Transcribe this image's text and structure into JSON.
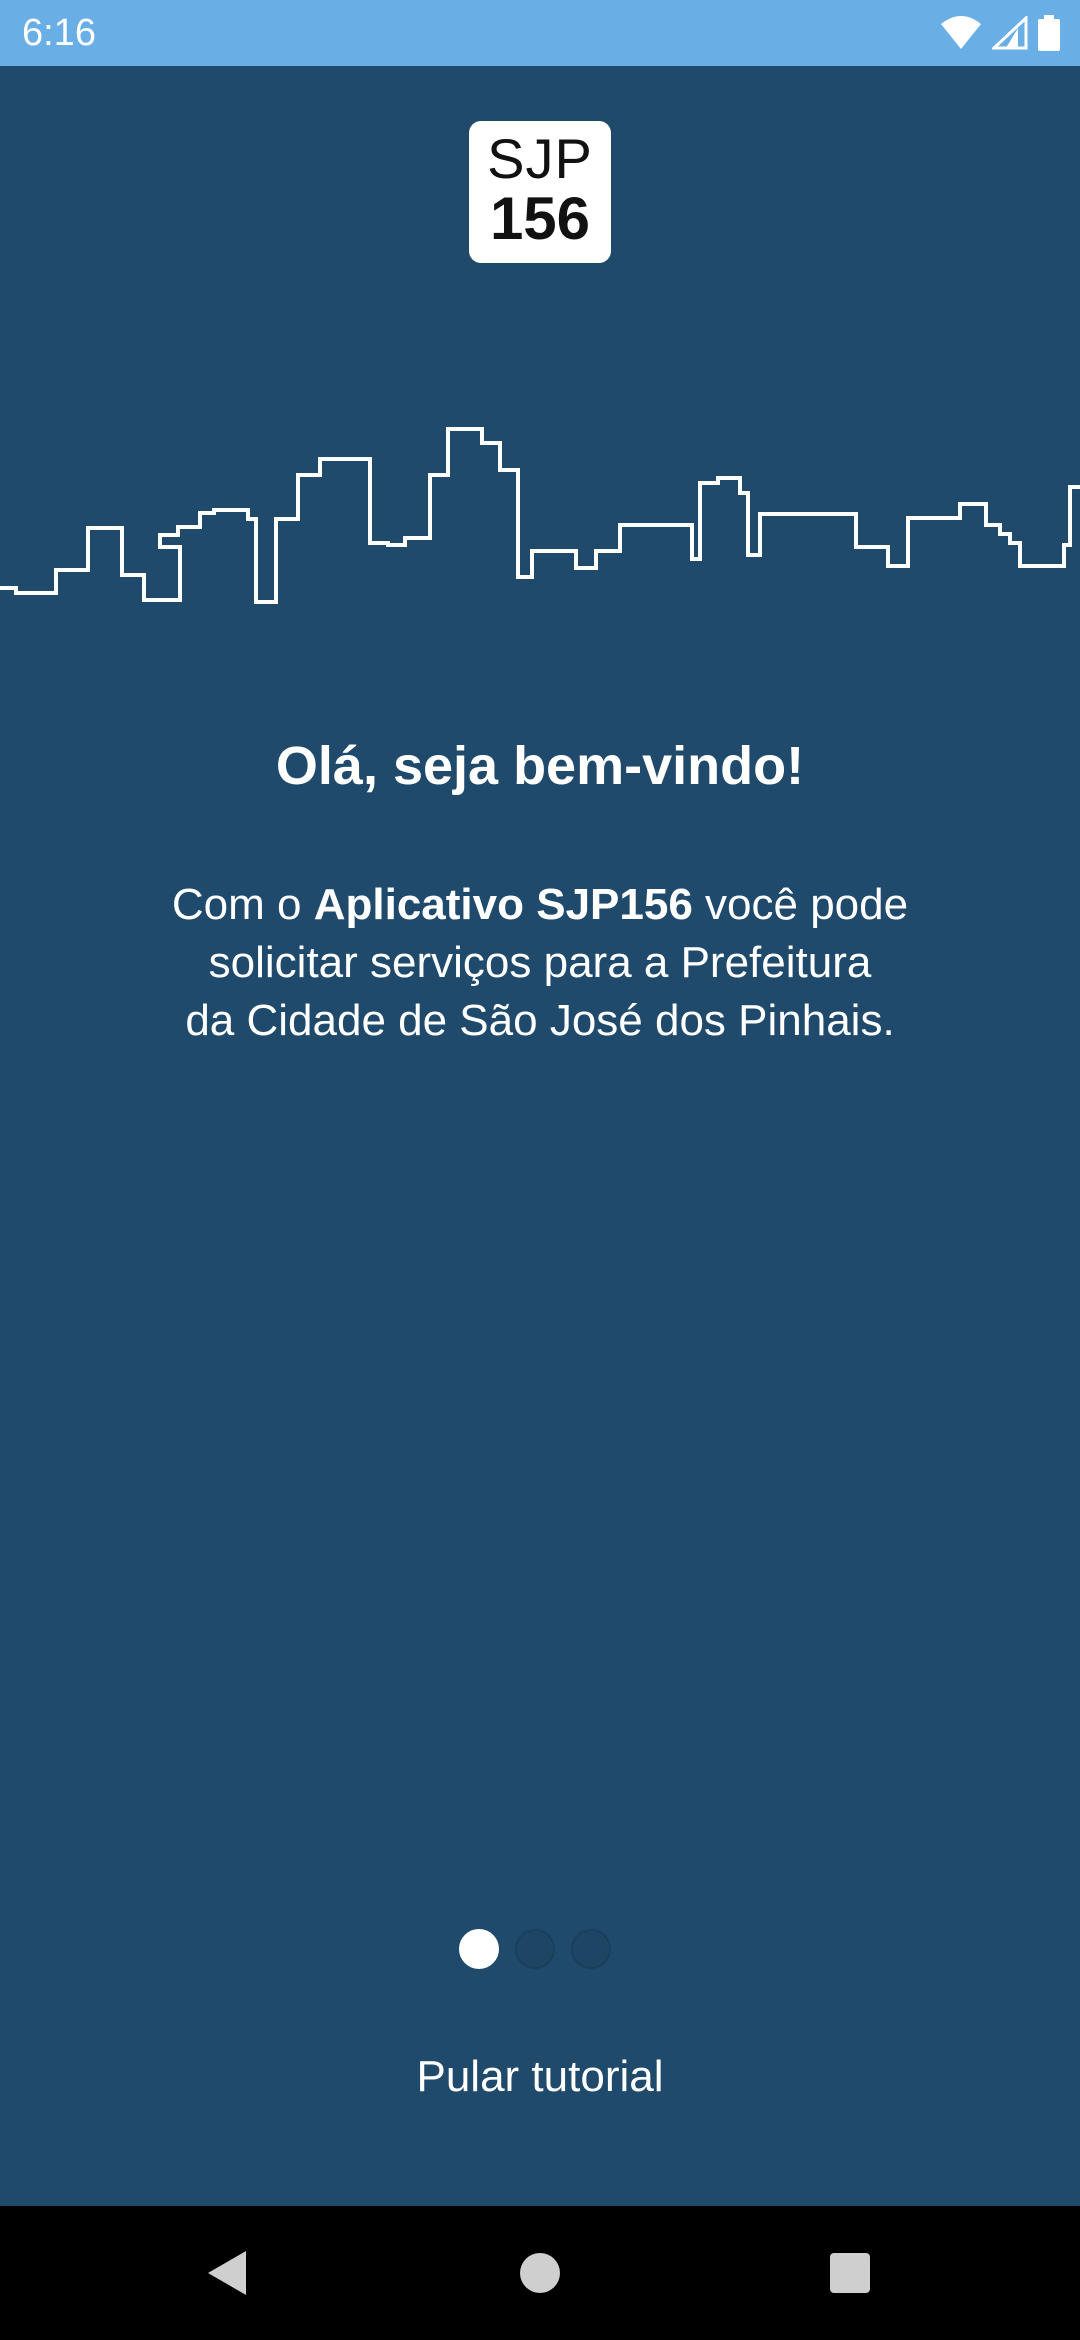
{
  "status_bar": {
    "time": "6:16",
    "icons": [
      "wifi-icon",
      "cellular-signal-icon",
      "battery-icon"
    ],
    "background": "#6aaee6"
  },
  "logo": {
    "line1": "SJP",
    "line2": "156"
  },
  "welcome": {
    "title": "Olá, seja bem-vindo!",
    "desc_prefix": "Com o ",
    "desc_app_name": "Aplicativo SJP156",
    "desc_line1_suffix": " você pode",
    "desc_line2": "solicitar serviços para a Prefeitura",
    "desc_line3": "da Cidade de São José dos Pinhais."
  },
  "pager": {
    "total_pages": 3,
    "current_page": 1
  },
  "skip_label": "Pular tutorial",
  "nav_bar": {
    "buttons": [
      "back-icon",
      "home-icon",
      "recents-icon"
    ]
  },
  "colors": {
    "background": "#1f4a6b",
    "accent": "#ffffff"
  }
}
